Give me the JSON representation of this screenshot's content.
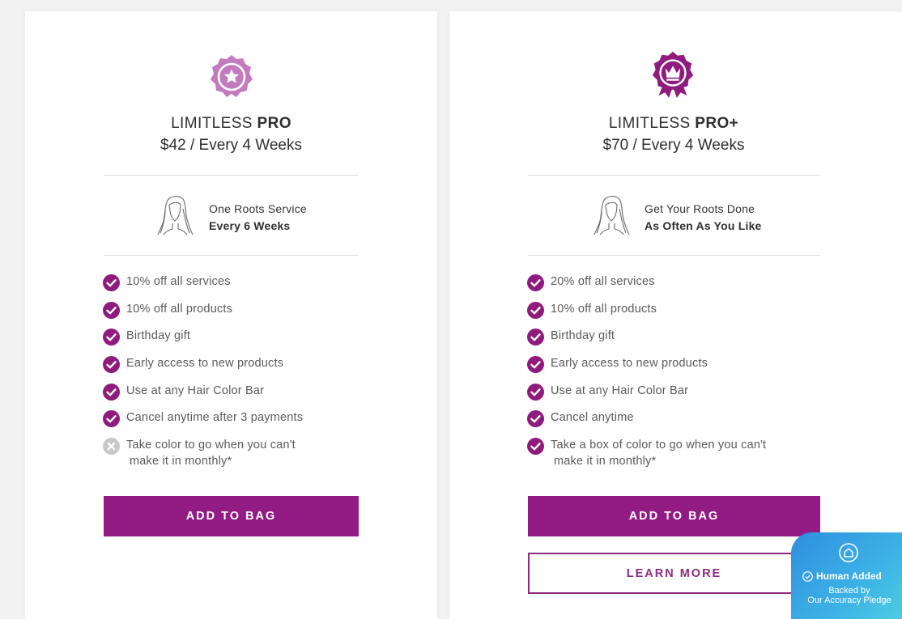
{
  "colors": {
    "brand": "#921b84",
    "badge_pro": "#c27bbe",
    "check": "#8e1b7d",
    "cross": "#c8c8c8",
    "pledge": "#3aa8e4"
  },
  "plans": [
    {
      "name_prefix": "LIMITLESS ",
      "name_bold": "PRO",
      "price": "$42 / Every 4 Weeks",
      "badge_icon": "star-badge-icon",
      "roots_line1": "One Roots Service",
      "roots_line2": "Every 6 Weeks",
      "benefits": [
        {
          "text": "10% off all services",
          "included": true
        },
        {
          "text": "10% off all products",
          "included": true
        },
        {
          "text": "Birthday gift",
          "included": true
        },
        {
          "text": "Early access to new products",
          "included": true
        },
        {
          "text": "Use at any Hair Color Bar",
          "included": true
        },
        {
          "text": "Cancel anytime after 3 payments",
          "included": true
        },
        {
          "text": "Take color to go when you can't",
          "text_cont": "make it in monthly*",
          "included": false
        }
      ],
      "add_button": "ADD TO BAG"
    },
    {
      "name_prefix": "LIMITLESS ",
      "name_bold": "PRO+",
      "price": "$70 / Every 4 Weeks",
      "badge_icon": "crown-badge-icon",
      "roots_line1": "Get Your Roots Done",
      "roots_line2": "As Often As You Like",
      "benefits": [
        {
          "text": "20% off all services",
          "included": true
        },
        {
          "text": "10% off all products",
          "included": true
        },
        {
          "text": "Birthday gift",
          "included": true
        },
        {
          "text": "Early access to new products",
          "included": true
        },
        {
          "text": "Use at any Hair Color Bar",
          "included": true
        },
        {
          "text": "Cancel anytime",
          "included": true
        },
        {
          "text": "Take a box of color to go when you can't",
          "text_cont": "make it in monthly*",
          "included": true
        }
      ],
      "add_button": "ADD TO BAG",
      "learn_button": "LEARN MORE"
    }
  ],
  "pledge": {
    "title": "Human Added",
    "sub_line1": "Backed by",
    "sub_line2": "Our Accuracy Pledge"
  }
}
